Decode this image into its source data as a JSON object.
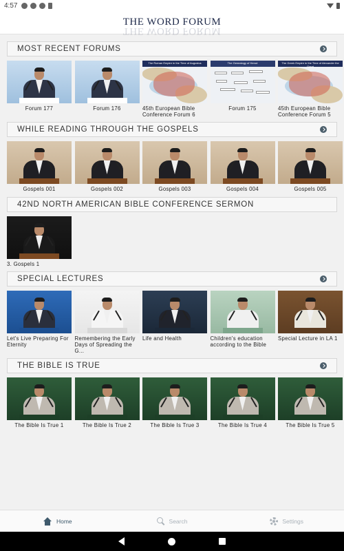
{
  "status": {
    "time": "4:57"
  },
  "header": {
    "logo": "THE WORD FORUM"
  },
  "sections": [
    {
      "title": "MOST RECENT FORUMS",
      "has_arrow": true,
      "items": [
        {
          "caption": "Forum 177",
          "thumb": "speaker-blue"
        },
        {
          "caption": "Forum 176",
          "thumb": "speaker-blue"
        },
        {
          "caption": "45th European Bible Conference Forum 6",
          "thumb": "map",
          "map_title": "The Roman Empire in the Time of Augustus"
        },
        {
          "caption": "Forum 175",
          "thumb": "chart",
          "map_title": "The Genealogy of Herod"
        },
        {
          "caption": "45th European Bible Conference Forum 5",
          "thumb": "map",
          "map_title": "The Greek Empire in the Time of Alexander the Great"
        }
      ]
    },
    {
      "title": "WHILE READING THROUGH THE GOSPELS",
      "has_arrow": true,
      "items": [
        {
          "caption": "Gospels 001",
          "thumb": "speaker-tan"
        },
        {
          "caption": "Gospels 002",
          "thumb": "speaker-tan"
        },
        {
          "caption": "Gospels 003",
          "thumb": "speaker-tan"
        },
        {
          "caption": "Gospels 004",
          "thumb": "speaker-tan"
        },
        {
          "caption": "Gospels 005",
          "thumb": "speaker-tan"
        }
      ]
    },
    {
      "title": "42ND NORTH AMERICAN BIBLE CONFERENCE SERMON",
      "has_arrow": false,
      "items": [
        {
          "caption": "3. Gospels 1",
          "thumb": "speaker-black"
        }
      ]
    },
    {
      "title": "SPECIAL LECTURES",
      "has_arrow": true,
      "items": [
        {
          "caption": "Let's Live Preparing For Eternity",
          "thumb": "speaker-blue-dark"
        },
        {
          "caption": "Remembering the Early Days of Spreading the G...",
          "thumb": "speaker-white"
        },
        {
          "caption": "Life and Health",
          "thumb": "speaker-navy"
        },
        {
          "caption": "Children's education according to the Bible",
          "thumb": "speaker-green"
        },
        {
          "caption": "Special Lecture in LA 1",
          "thumb": "speaker-brown"
        }
      ]
    },
    {
      "title": "THE BIBLE IS TRUE",
      "has_arrow": true,
      "items": [
        {
          "caption": "The Bible Is True 1",
          "thumb": "speaker-forest"
        },
        {
          "caption": "The Bible Is True 2",
          "thumb": "speaker-forest"
        },
        {
          "caption": "The Bible Is True 3",
          "thumb": "speaker-forest"
        },
        {
          "caption": "The Bible Is True 4",
          "thumb": "speaker-forest"
        },
        {
          "caption": "The Bible Is True 5",
          "thumb": "speaker-forest"
        }
      ]
    }
  ],
  "bottom_nav": [
    {
      "label": "Home",
      "icon": "home-icon",
      "active": true
    },
    {
      "label": "Search",
      "icon": "search-icon",
      "active": false
    },
    {
      "label": "Settings",
      "icon": "gear-icon",
      "active": false
    }
  ],
  "colors": {
    "accent": "#3f5a6c",
    "inactive": "#aab2b9",
    "section_bg": "#f7f7f7",
    "page_bg": "#f1f1f1"
  }
}
